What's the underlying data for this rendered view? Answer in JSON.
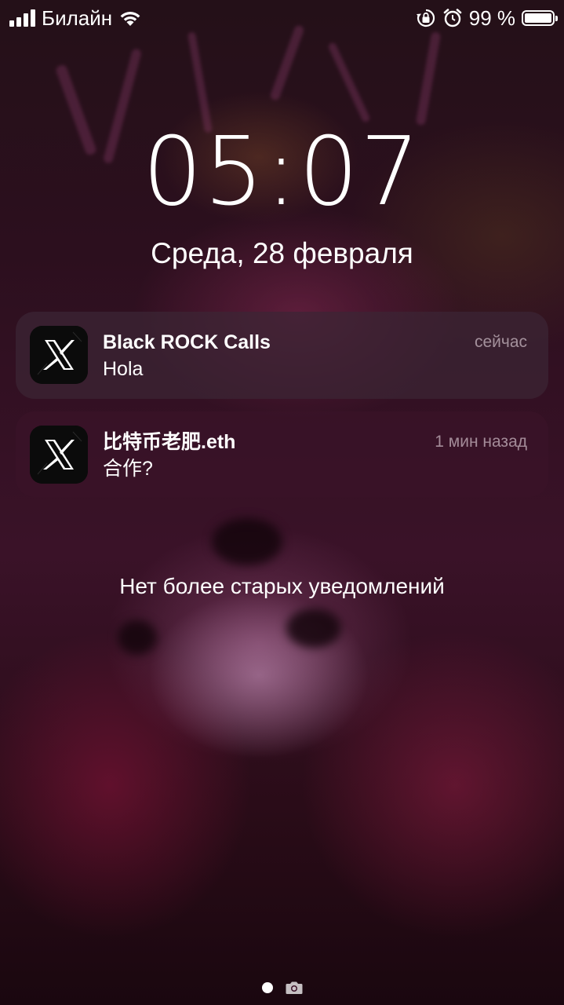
{
  "status_bar": {
    "carrier": "Билайн",
    "battery_percent": "99 %",
    "icons": [
      "signal-icon",
      "wifi-icon",
      "orientation-lock-icon",
      "alarm-icon",
      "battery-icon"
    ]
  },
  "lock_screen": {
    "time": "05:07",
    "date": "Среда, 28 февраля"
  },
  "notifications": [
    {
      "app_icon": "x-logo-icon",
      "title": "Black ROCK Calls",
      "body": "Hola",
      "time": "сейчас"
    },
    {
      "app_icon": "x-logo-icon",
      "title": "比特币老肥.eth",
      "body": "合作?",
      "time": "1 мин назад"
    }
  ],
  "no_older_notifications": "Нет более старых уведомлений",
  "page_indicator": {
    "icons": [
      "page-dot",
      "camera-icon"
    ]
  }
}
